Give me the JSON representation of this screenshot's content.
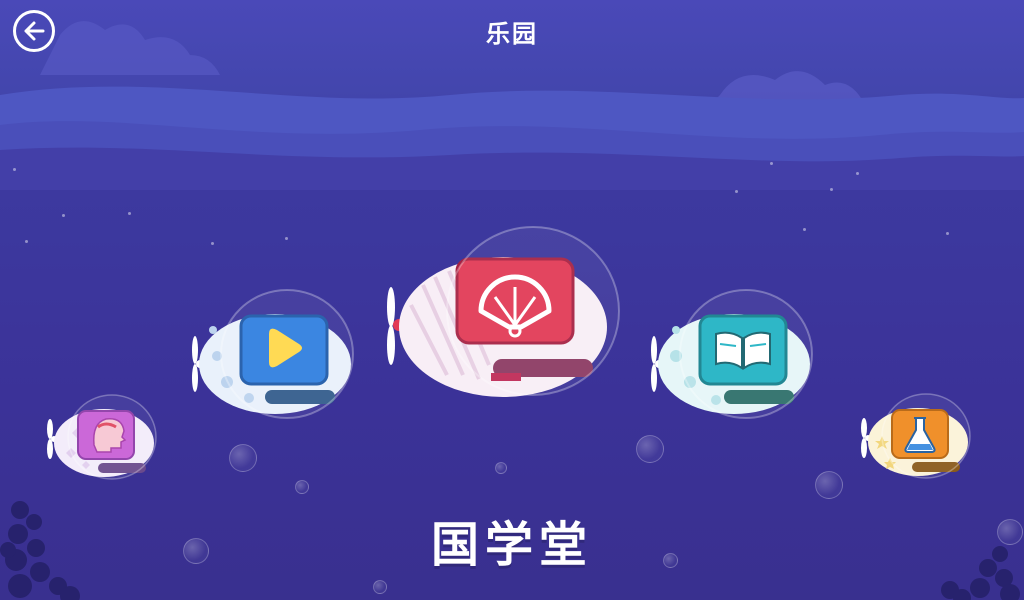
{
  "header": {
    "title": "乐园",
    "back_icon": "arrow-left-icon"
  },
  "caption": "国学堂",
  "submarines": [
    {
      "name": "brain",
      "icon": "head-profile-icon",
      "color": "#c85fd6",
      "selected": false
    },
    {
      "name": "video",
      "icon": "play-icon",
      "color": "#2f7fe0",
      "selected": false
    },
    {
      "name": "guoxue",
      "icon": "fan-icon",
      "color": "#e23a55",
      "selected": true
    },
    {
      "name": "reading",
      "icon": "book-icon",
      "color": "#21b3c4",
      "selected": false
    },
    {
      "name": "science",
      "icon": "flask-icon",
      "color": "#f08a1e",
      "selected": false
    }
  ]
}
